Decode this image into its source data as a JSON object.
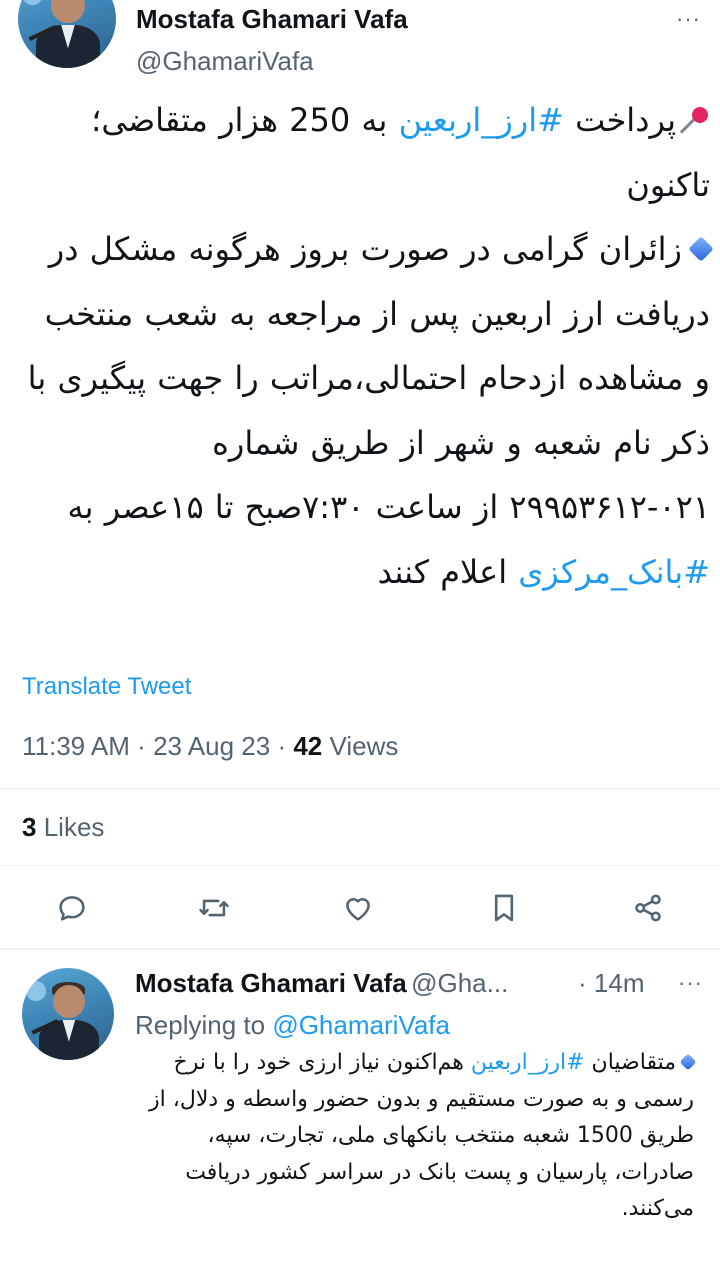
{
  "tweet": {
    "author_name": "Mostafa Ghamari Vafa",
    "author_handle": "@GhamariVafa",
    "more_label": "···",
    "body": {
      "line1_text_pre": "پرداخت ",
      "line1_hashtag": "#ارز_اربعین",
      "line1_text_post": " به 250 هزار متقاضی؛تاکنون",
      "para2": "زائران گرامی در صورت بروز هرگونه مشکل در دریافت ارز اربعین پس از مراجعه به شعب منتخب و مشاهده ازدحام احتمالی،مراتب را جهت پیگیری با ذکر نام شعبه و شهر از طریق شماره ۰۲۱-۲۹۹۵۳۶۱۲ از ساعت ۷:۳۰صبح تا ۱۵عصر به ",
      "para2_hashtag": "#بانک_مرکزی",
      "para2_post": " اعلام کنند"
    },
    "translate_label": "Translate Tweet",
    "time": "11:39 AM",
    "date": "23 Aug 23",
    "separator": "·",
    "views_count": "42",
    "views_label": "Views",
    "likes_count": "3",
    "likes_label": "Likes",
    "actions": [
      "reply-icon",
      "retweet-icon",
      "like-icon",
      "bookmark-icon",
      "share-icon"
    ]
  },
  "reply": {
    "author_name": "Mostafa Ghamari Vafa",
    "author_handle": "@Gha...",
    "separator": "·",
    "time_ago": "14m",
    "more_label": "···",
    "replying_prefix": "Replying to",
    "replying_to": "@GhamariVafa",
    "body_pre": "متقاضیان ",
    "body_hashtag": "#ارز_اربعین",
    "body_post": " هم‌اکنون نیاز ارزی خود را با نرخ رسمی و به صورت مستقیم و بدون حضور واسطه و دلال، از طریق 1500 شعبه منتخب بانکهای ملی، تجارت، سپه، صادرات، پارسیان و پست بانک در سراسر کشور دریافت می‌کنند."
  },
  "colors": {
    "accent": "#1d9bf0",
    "text": "#0f1419",
    "secondary": "#536471",
    "divider": "#eff3f4"
  }
}
